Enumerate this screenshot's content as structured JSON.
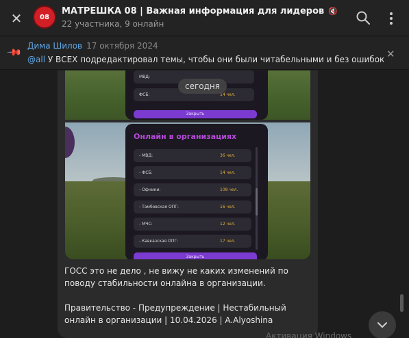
{
  "header": {
    "title": "МАТРЕШКА 08 | Важная информация для лидеров",
    "subtitle": "22 участника, 9 онлайн",
    "avatar_text": "08",
    "avatar_color": "#d21f26"
  },
  "pinned": {
    "author": "Дима Шилов",
    "date": "17 октября 2024",
    "mention": "@all",
    "text": " У ВСЕХ подредактировал темы, чтобы они были читабельными и без ошибок,..."
  },
  "date_pill": "сегодня",
  "screenshot_top": {
    "rows": [
      {
        "name": "МВД:",
        "value": ""
      },
      {
        "name": "ФСБ:",
        "value": "14 чел."
      }
    ],
    "button": "Закрыть"
  },
  "screenshot_main": {
    "title": "Онлайн в организациях",
    "rows": [
      {
        "name": "- МВД:",
        "value": "36 чел."
      },
      {
        "name": "- ФСБ:",
        "value": "14 чел."
      },
      {
        "name": "- Офники:",
        "value": "108 чел."
      },
      {
        "name": "- Тамбовская ОПГ:",
        "value": "16 чел."
      },
      {
        "name": "- МЧС:",
        "value": "12 чел."
      },
      {
        "name": "- Кавказская ОПГ:",
        "value": "17 чел."
      }
    ],
    "button": "Закрыть"
  },
  "message": {
    "paragraph1": "ГОСС это не дело , не вижу не каких изменений по поводу стабильности онлайна в организации.",
    "paragraph2": "Правительство - Предупреждение | Нестабильный онлайн в организации | 10.04.2026 | A.Alyoshina"
  },
  "icons": {
    "close": "close-icon",
    "search": "search-icon",
    "more": "more-vertical-icon",
    "pin": "pin-icon",
    "mute": "mute-icon",
    "scroll_down": "chevron-down-icon"
  },
  "watermark": "Активация Windows"
}
